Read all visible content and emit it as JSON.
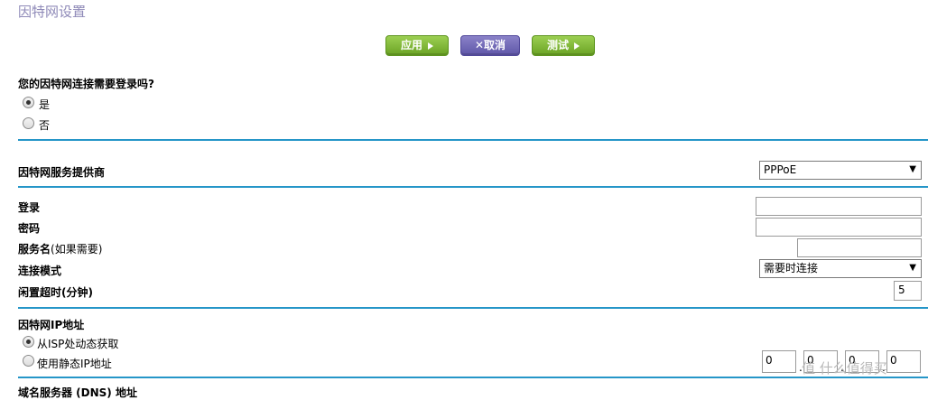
{
  "title": "因特网设置",
  "toolbar": {
    "apply_label": "应用",
    "cancel_label": "✕取消",
    "test_label": "测试"
  },
  "login_question": {
    "label": "您的因特网连接需要登录吗?",
    "options": [
      "是",
      "否"
    ],
    "selected": "是"
  },
  "isp": {
    "label": "因特网服务提供商",
    "value": "PPPoE"
  },
  "fields": {
    "login_label": "登录",
    "login_value": "",
    "password_label": "密码",
    "password_value": "",
    "service_label": "服务名",
    "service_hint": "(如果需要)",
    "service_value": "",
    "mode_label": "连接模式",
    "mode_value": "需要时连接",
    "idle_label": "闲置超时(分钟)",
    "idle_value": "5"
  },
  "ip_section": {
    "label": "因特网IP地址",
    "options": [
      "从ISP处动态获取",
      "使用静态IP地址"
    ],
    "selected": "从ISP处动态获取",
    "octets": [
      "0",
      "0",
      "0",
      "0"
    ]
  },
  "dns_section": {
    "label": "域名服务器 (DNS) 地址"
  },
  "watermark": "值 什么值得买"
}
